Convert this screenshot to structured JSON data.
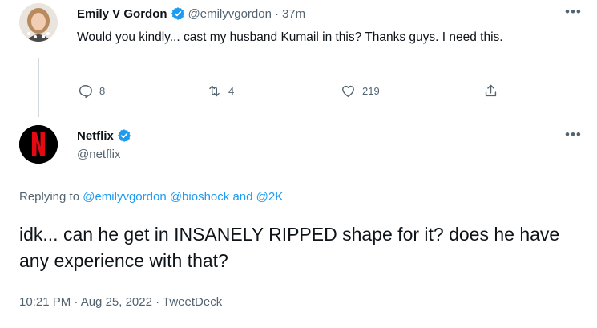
{
  "reply_tweet": {
    "display_name": "Emily V Gordon",
    "handle": "@emilyvgordon",
    "separator": "·",
    "time": "37m",
    "text": "Would you kindly... cast my husband Kumail in this? Thanks guys. I need this.",
    "counts": {
      "replies": "8",
      "retweets": "4",
      "likes": "219"
    }
  },
  "main_tweet": {
    "display_name": "Netflix",
    "handle": "@netflix",
    "replying_prefix": "Replying to",
    "mention_1": "@emilyvgordon",
    "mention_2": "@bioshock",
    "and_word": "and",
    "mention_3": "@2K",
    "text": "idk... can he get in INSANELY RIPPED shape for it? does he have any experience with that?",
    "timestamp": "10:21 PM · Aug 25, 2022 · TweetDeck"
  },
  "icons": {
    "more": "more-icon",
    "verified": "verified-icon",
    "reply": "reply-icon",
    "retweet": "retweet-icon",
    "like": "like-icon",
    "share": "share-icon"
  },
  "colors": {
    "accent": "#1d9bf0",
    "muted": "#536471",
    "netflix_red": "#e50914"
  }
}
